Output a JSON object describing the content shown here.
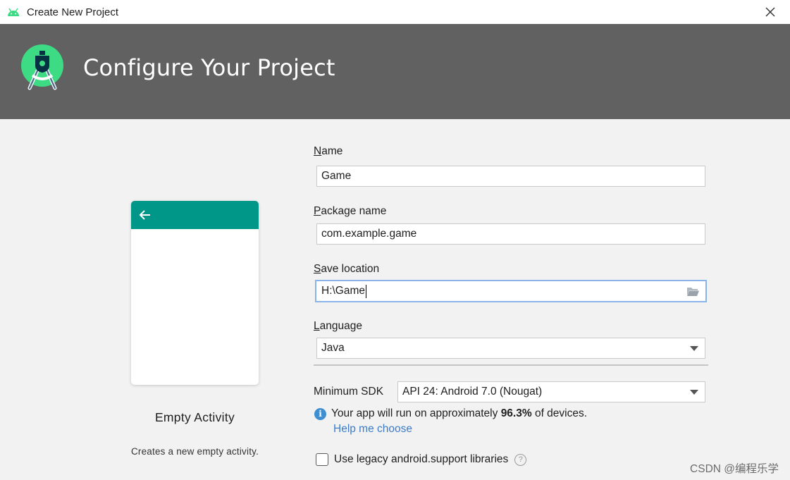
{
  "window": {
    "title": "Create New Project"
  },
  "header": {
    "heading": "Configure Your Project"
  },
  "template": {
    "name": "Empty Activity",
    "description": "Creates a new empty activity.",
    "appbar_color": "#009688"
  },
  "form": {
    "name": {
      "mnemonic": "N",
      "label_rest": "ame",
      "value": "Game"
    },
    "package": {
      "mnemonic": "P",
      "label_rest": "ackage name",
      "value": "com.example.game"
    },
    "location": {
      "mnemonic": "S",
      "label_rest": "ave location",
      "value": "H:\\Game"
    },
    "language": {
      "mnemonic": "L",
      "label_rest": "anguage",
      "value": "Java"
    },
    "min_sdk": {
      "label": "Minimum SDK",
      "value": "API 24: Android 7.0 (Nougat)"
    },
    "info": {
      "prefix": "Your app will run on approximately",
      "percent": "96.3%",
      "suffix": "of devices."
    },
    "help_link": "Help me choose",
    "legacy": {
      "label": "Use legacy android.support libraries",
      "checked": false
    }
  },
  "icons": {
    "app": "android-head-icon",
    "close": "close-icon",
    "logo": "android-studio-logo-icon",
    "back": "back-arrow-icon",
    "folder": "folder-open-icon",
    "dropdown": "chevron-down-icon",
    "info": "info-icon",
    "help": "question-icon"
  },
  "watermark": "CSDN @编程乐学"
}
